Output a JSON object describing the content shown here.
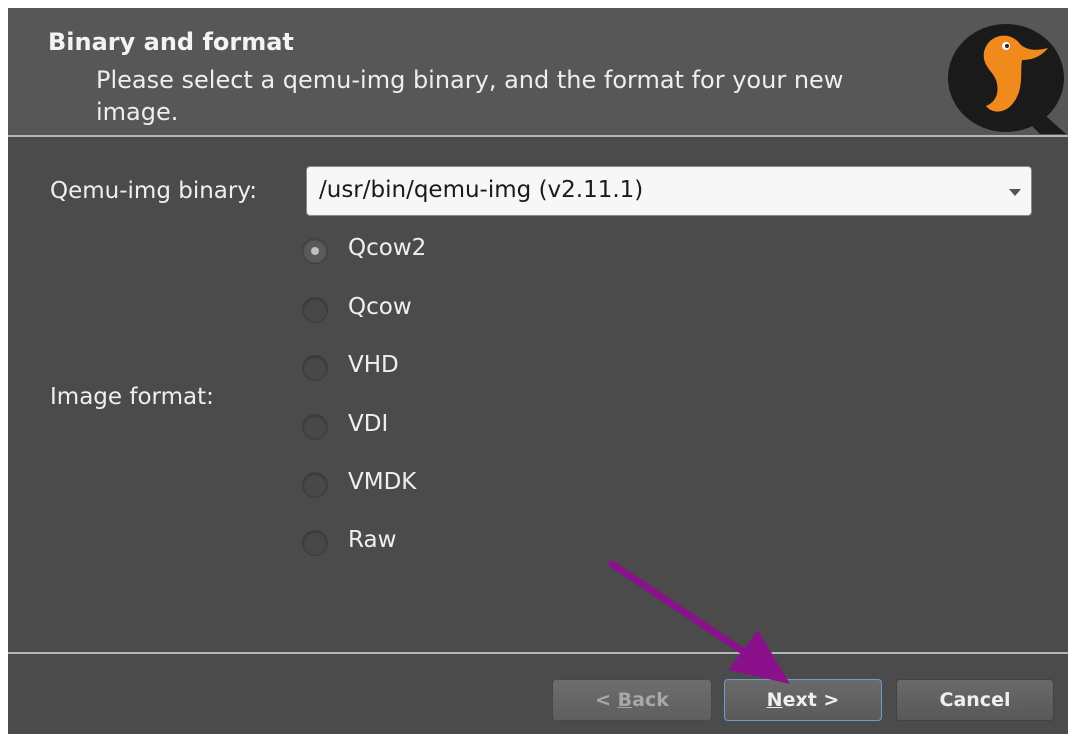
{
  "header": {
    "title": "Binary and format",
    "subtitle": "Please select a qemu-img binary, and the format for your new image."
  },
  "binary": {
    "label": "Qemu-img binary:",
    "value": "/usr/bin/qemu-img (v2.11.1)"
  },
  "format": {
    "label": "Image format:",
    "options": [
      {
        "label": "Qcow2",
        "checked": true
      },
      {
        "label": "Qcow",
        "checked": false
      },
      {
        "label": "VHD",
        "checked": false
      },
      {
        "label": "VDI",
        "checked": false
      },
      {
        "label": "VMDK",
        "checked": false
      },
      {
        "label": "Raw",
        "checked": false
      }
    ]
  },
  "buttons": {
    "back": {
      "mnemonic": "B",
      "rest": "ack",
      "prefix": "< ",
      "enabled": false
    },
    "next": {
      "mnemonic": "N",
      "rest": "ext >",
      "prefix": ""
    },
    "cancel": "Cancel"
  },
  "colors": {
    "annotation_arrow": "#8b118c",
    "focus_border": "#6f9ccd"
  },
  "icons": {
    "logo": "qemu-logo-icon",
    "dropdown": "chevron-down-icon"
  }
}
